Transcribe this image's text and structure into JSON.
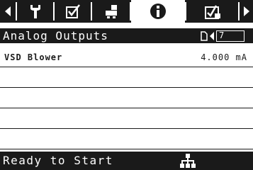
{
  "tabs": [
    {
      "id": "prev",
      "icon": "left-arrow-icon"
    },
    {
      "id": "service",
      "icon": "wrench-icon"
    },
    {
      "id": "checklist",
      "icon": "checkbox-icon"
    },
    {
      "id": "network",
      "icon": "network-blocks-icon"
    },
    {
      "id": "info",
      "icon": "info-icon",
      "active": true
    },
    {
      "id": "maintenance",
      "icon": "maintenance-icon"
    },
    {
      "id": "next",
      "icon": "right-arrow-icon"
    }
  ],
  "title": "Analog Outputs",
  "pager": {
    "page": "7"
  },
  "rows": [
    {
      "label": "VSD Blower",
      "value": "4.000 mA"
    },
    {
      "label": "",
      "value": ""
    },
    {
      "label": "",
      "value": ""
    },
    {
      "label": "",
      "value": ""
    },
    {
      "label": "",
      "value": ""
    }
  ],
  "status": "Ready to Start",
  "status_icon": "network-status-icon",
  "colors": {
    "bar": "#1a1a1a",
    "background": "#ffffff",
    "foreground": "#ffffff"
  }
}
